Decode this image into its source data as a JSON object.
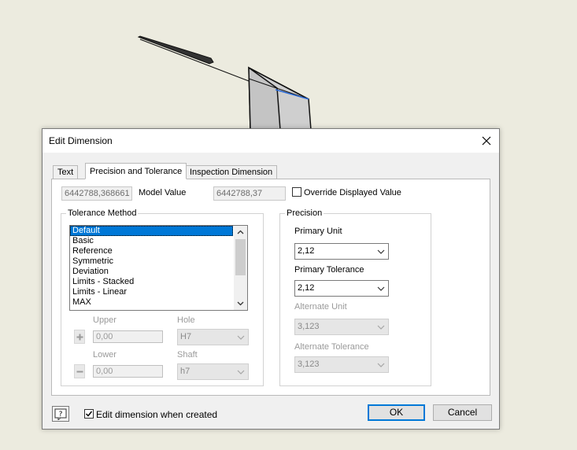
{
  "dialog": {
    "title": "Edit Dimension",
    "tabs": [
      {
        "label": "Text",
        "active": false
      },
      {
        "label": "Precision and Tolerance",
        "active": true
      },
      {
        "label": "Inspection Dimension",
        "active": false
      }
    ]
  },
  "model_value": {
    "raw": "6442788,368661",
    "label": "Model Value",
    "rounded": "6442788,37",
    "override_label": "Override Displayed Value",
    "override_checked": false
  },
  "tolerance_method": {
    "title": "Tolerance Method",
    "items": [
      "Default",
      "Basic",
      "Reference",
      "Symmetric",
      "Deviation",
      "Limits - Stacked",
      "Limits - Linear",
      "MAX"
    ],
    "selected": "Default",
    "upper_label": "Upper",
    "upper_value": "0,00",
    "lower_label": "Lower",
    "lower_value": "0,00",
    "hole_label": "Hole",
    "hole_value": "H7",
    "shaft_label": "Shaft",
    "shaft_value": "h7"
  },
  "precision": {
    "title": "Precision",
    "primary_unit_label": "Primary Unit",
    "primary_unit_value": "2,12",
    "primary_tolerance_label": "Primary Tolerance",
    "primary_tolerance_value": "2,12",
    "alternate_unit_label": "Alternate Unit",
    "alternate_unit_value": "3,123",
    "alternate_tolerance_label": "Alternate Tolerance",
    "alternate_tolerance_value": "3,123"
  },
  "footer": {
    "edit_when_created_label": "Edit dimension when created",
    "edit_when_created_checked": true,
    "ok_label": "OK",
    "cancel_label": "Cancel"
  },
  "icons": {
    "close": "close-icon",
    "help": "help-icon",
    "chevron": "chevron-down-icon",
    "plus": "plus-icon",
    "minus": "minus-icon"
  },
  "colors": {
    "background": "#ecebdf",
    "selection": "#0078d7",
    "default_button_border": "#0078d7"
  }
}
